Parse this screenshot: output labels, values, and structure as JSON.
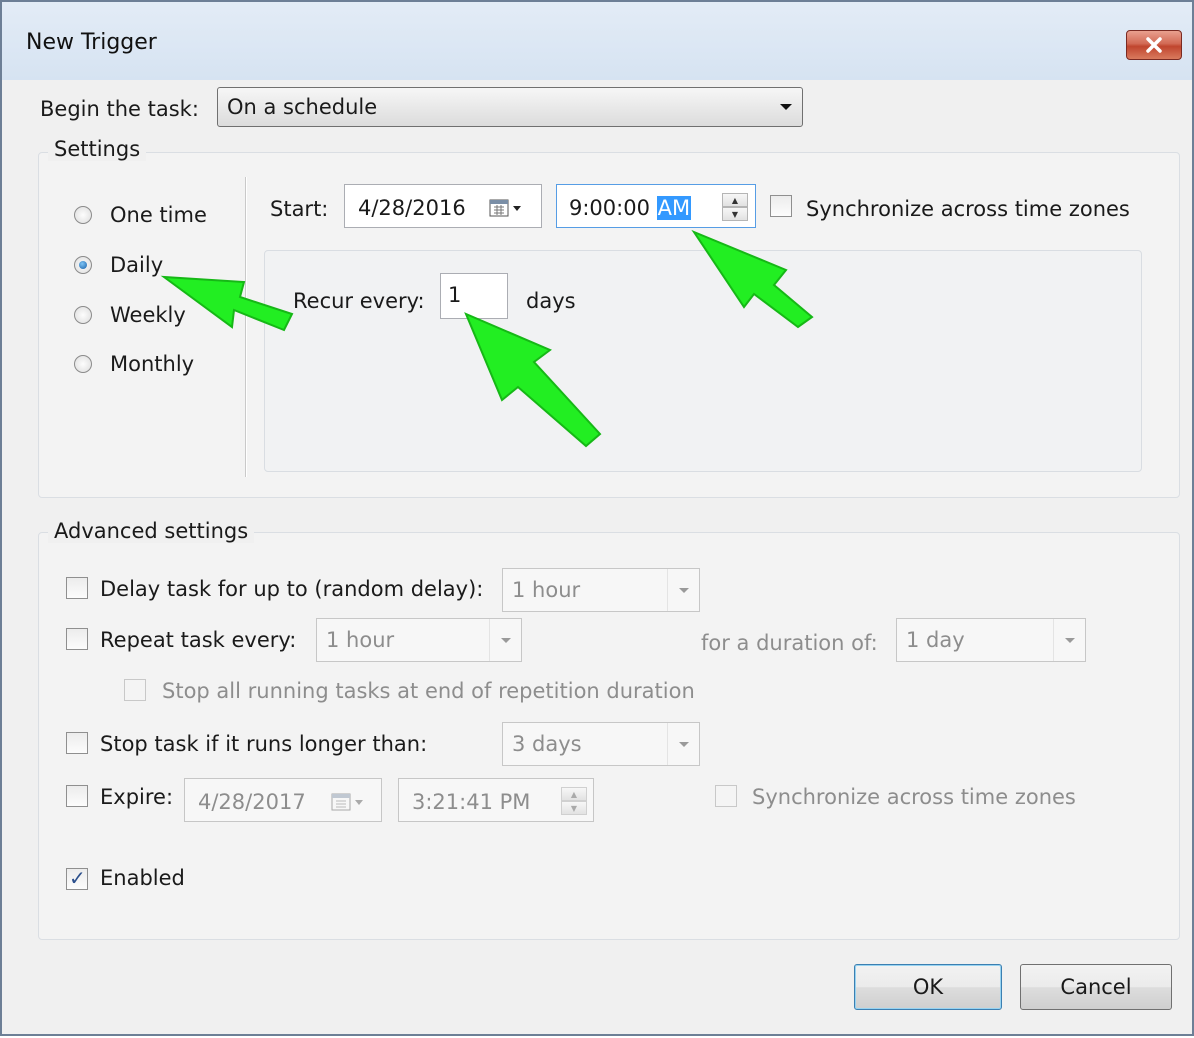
{
  "window": {
    "title": "New Trigger"
  },
  "begin": {
    "label": "Begin the task:",
    "value": "On a schedule"
  },
  "settings": {
    "title": "Settings",
    "radios": [
      {
        "label": "One time",
        "checked": false
      },
      {
        "label": "Daily",
        "checked": true
      },
      {
        "label": "Weekly",
        "checked": false
      },
      {
        "label": "Monthly",
        "checked": false
      }
    ],
    "start_label": "Start:",
    "start_date": "4/28/2016",
    "start_time_main": "9:00:00 ",
    "start_time_ampm": "AM",
    "sync_label": "Synchronize across time zones",
    "recur_label": "Recur every:",
    "recur_value": "1",
    "recur_unit": "days"
  },
  "advanced": {
    "title": "Advanced settings",
    "delay_label": "Delay task for up to (random delay):",
    "delay_value": "1 hour",
    "repeat_label": "Repeat task every:",
    "repeat_value": "1 hour",
    "duration_label": "for a duration of:",
    "duration_value": "1 day",
    "stop_all_label": "Stop all running tasks at end of repetition duration",
    "stop_longer_label": "Stop task if it runs longer than:",
    "stop_longer_value": "3 days",
    "expire_label": "Expire:",
    "expire_date": "4/28/2017",
    "expire_time": "3:21:41 PM",
    "expire_sync_label": "Synchronize across time zones",
    "enabled_label": "Enabled",
    "enabled_checked": true
  },
  "buttons": {
    "ok": "OK",
    "cancel": "Cancel"
  },
  "colors": {
    "annotation_arrow": "#22ee22",
    "selection": "#3399ff",
    "close_button": "#c7472f"
  }
}
